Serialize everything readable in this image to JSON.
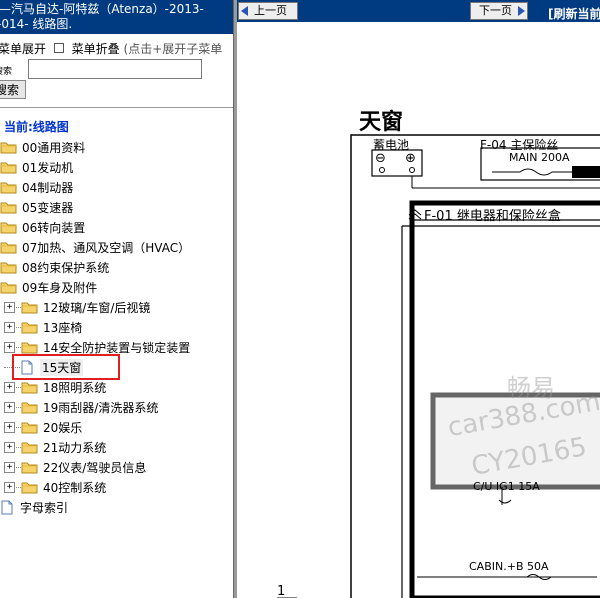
{
  "header": {
    "title_line1": "—汽马自达-阿特兹（Atenza）-2013-",
    "title_line2": "-014- 线路图."
  },
  "menu": {
    "expand": "菜单展开",
    "collapse": "菜单折叠",
    "hint": "(点击+展开子菜单"
  },
  "search": {
    "label": "搜索",
    "value": "",
    "button": "搜索"
  },
  "current": "当前:线路图",
  "tree": [
    {
      "label": "00通用资料",
      "type": "folder",
      "level": 0
    },
    {
      "label": "01发动机",
      "type": "folder",
      "level": 0
    },
    {
      "label": "04制动器",
      "type": "folder",
      "level": 0
    },
    {
      "label": "05变速器",
      "type": "folder",
      "level": 0
    },
    {
      "label": "06转向装置",
      "type": "folder",
      "level": 0
    },
    {
      "label": "07加热、通风及空调（HVAC）",
      "type": "folder",
      "level": 0
    },
    {
      "label": "08约束保护系统",
      "type": "folder",
      "level": 0
    },
    {
      "label": "09车身及附件",
      "type": "folder",
      "level": 0
    },
    {
      "label": "12玻璃/车窗/后视镜",
      "type": "folder",
      "level": 1
    },
    {
      "label": "13座椅",
      "type": "folder",
      "level": 1
    },
    {
      "label": "14安全防护装置与锁定装置",
      "type": "folder",
      "level": 1
    },
    {
      "label": "15天窗",
      "type": "page",
      "level": 1,
      "selected": true
    },
    {
      "label": "18照明系统",
      "type": "folder",
      "level": 1
    },
    {
      "label": "19雨刮器/清洗器系统",
      "type": "folder",
      "level": 1
    },
    {
      "label": "20娱乐",
      "type": "folder",
      "level": 1
    },
    {
      "label": "21动力系统",
      "type": "folder",
      "level": 1
    },
    {
      "label": "22仪表/驾驶员信息",
      "type": "folder",
      "level": 1
    },
    {
      "label": "40控制系统",
      "type": "folder",
      "level": 1
    },
    {
      "label": "字母索引",
      "type": "page",
      "level": 0
    }
  ],
  "nav": {
    "prev": "上一页",
    "next": "下一页",
    "refresh": "[刷新当前"
  },
  "diagram": {
    "title": "天窗",
    "battery": "蓄电池",
    "minus": "⊖",
    "plus": "⊕",
    "fuse_main_box": "F-04 主保险丝",
    "main_fuse": "MAIN 200A",
    "relay_box": "F-01 继电器和保险丝盒",
    "fuse_cu_ig1": "C/U IG1 15A",
    "fuse_cabin": "CABIN.+B 50A",
    "bottom_mark": "1"
  },
  "watermark": {
    "line1": "畅易",
    "line2": "car388.com",
    "line3": "CY20165"
  },
  "colors": {
    "nav_bg": "#003a80",
    "highlight": "#e02020",
    "current": "#0033cc"
  }
}
